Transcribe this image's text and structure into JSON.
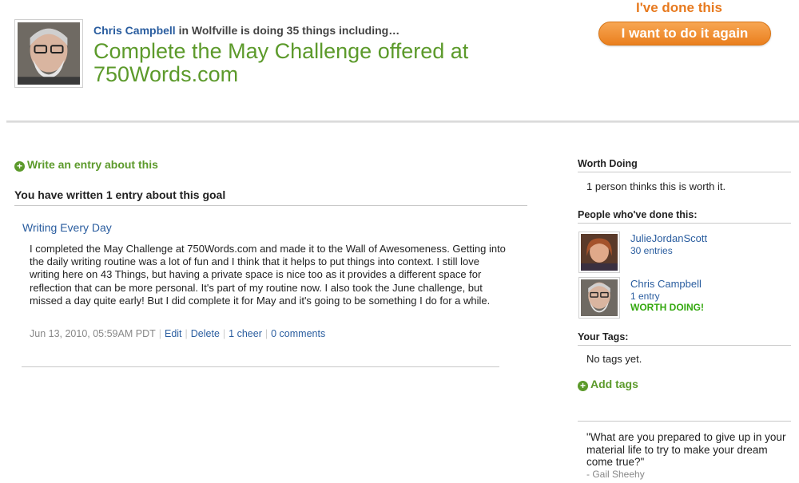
{
  "header": {
    "user_name": "Chris Campbell",
    "location_text": " in Wolfville is doing 35 things including…",
    "goal_title": "Complete the May Challenge offered at 750Words.com",
    "done_label": "I've done this",
    "again_button": "I want to do it again"
  },
  "main": {
    "write_entry_link": "Write an entry about this",
    "entries_heading": "You have written 1 entry about this goal",
    "entry": {
      "title": "Writing Every Day",
      "body": "I completed the May Challenge at 750Words.com and made it to the Wall of Awesomeness. Getting into the daily writing routine was a lot of fun and I think that it helps to put things into context. I still love writing here on 43 Things, but having a private space is nice too as it provides a different space for reflection that can be more personal. It's part of my routine now. I also took the June challenge, but missed a day quite early! But I did complete it for May and it's going to be something I do for a while.",
      "timestamp": "Jun 13, 2010, 05:59AM PDT",
      "edit": "Edit",
      "delete": "Delete",
      "cheers": "1 cheer",
      "comments": "0 comments"
    }
  },
  "sidebar": {
    "worth_heading": "Worth Doing",
    "worth_text": "1 person thinks this is worth it.",
    "people_heading": "People who've done this:",
    "people": [
      {
        "name": "JulieJordanScott",
        "sub": "30 entries"
      },
      {
        "name": "Chris Campbell",
        "sub": "1 entry",
        "badge": "WORTH DOING!"
      }
    ],
    "tags_heading": "Your Tags:",
    "tags_text": "No tags yet.",
    "add_tags": "Add tags",
    "quote": "\"What are you prepared to give up in your material life to try to make your dream come true?\"",
    "quote_author": "- Gail Sheehy"
  },
  "colors": {
    "accent_green": "#5c9a2b",
    "link_blue": "#2a5d9f",
    "orange": "#e77a1f",
    "worth_green": "#34a80f"
  }
}
